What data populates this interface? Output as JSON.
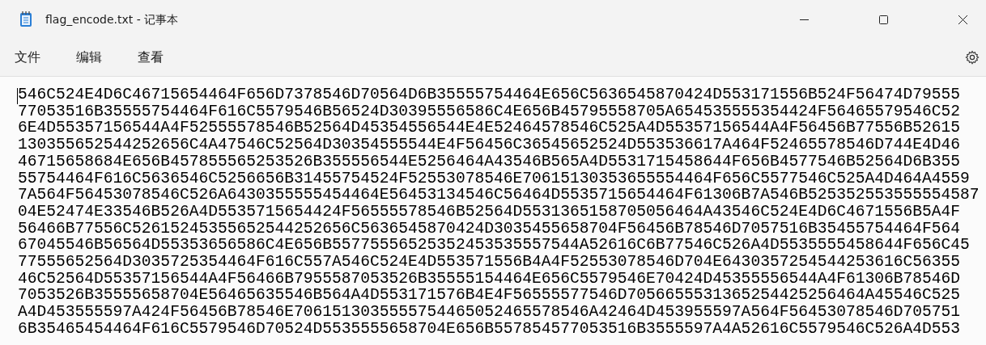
{
  "window": {
    "title": "flag_encode.txt - 记事本"
  },
  "menu": [
    "文件",
    "编辑",
    "查看"
  ],
  "editor": {
    "lines": [
      "546C524E4D6C46715654464F656D7378546D70564D6B35555754464E656C5636545870424D553171556B524F56474D79555",
      "77053516B35555754464F616C5579546B56524D30395556586C4E656B45795558705A654535555354424F56465579546C52",
      "6E4D55357156544A4F52555578546B52564D45354556544E4E52464578546C525A4D55357156544A4F56456B77556B52615",
      "130355652544252656C4A47546C52564D30354555544E4F56456C36545652524D553536617A464F52465578546D744E4D46",
      "46715658684E656B457855565253526B355556544E5256464A43546B565A4D5531715458644F656B4577546B52564D6B355",
      "55754464F616C5636546C5256656B31455754524F52553078546E70615130353655554464F656C5577546C525A4D464A4559",
      "7A564F56453078546C526A6430355555454464E56453134546C56464D5535715654464F61306B7A546B525352553555554587",
      "04E52474E33546B526A4D5535715654424F56555578546B52564D5531365158705056464A43546C524E4D6C4671556B5A4F",
      "56466B77556C52615245355652544252656C5636545870424D3035455658704F56456B78546D7057516B35455754464F564",
      "67045546B56564D55353656586C4E656B55775556525352453535557544A52616C6B77546C526A4D5535555458644F656C45",
      "77555652564D3035725354464F616C557A546C524E4D553571556B4A4F52553078546D704E6430357254544253616C56355",
      "46C52564D55357156544A4F56466B7955587053526B35555154464E656C5579546E70424D45355556544A4F61306B78546D",
      "7053526B35555658704E56465635546B564A4D553171576B4E4F56555577546D7056655531365254425256464A45546C525",
      "A4D453555597A424F56456B78546E7061513035555754465052465578546A42464D453955597A564F56453078546D705751",
      "6B35465454464F616C5579546D70524D5535555658704E656B557854577053516B3555597A4A52616C5579546C526A4D553"
    ]
  }
}
